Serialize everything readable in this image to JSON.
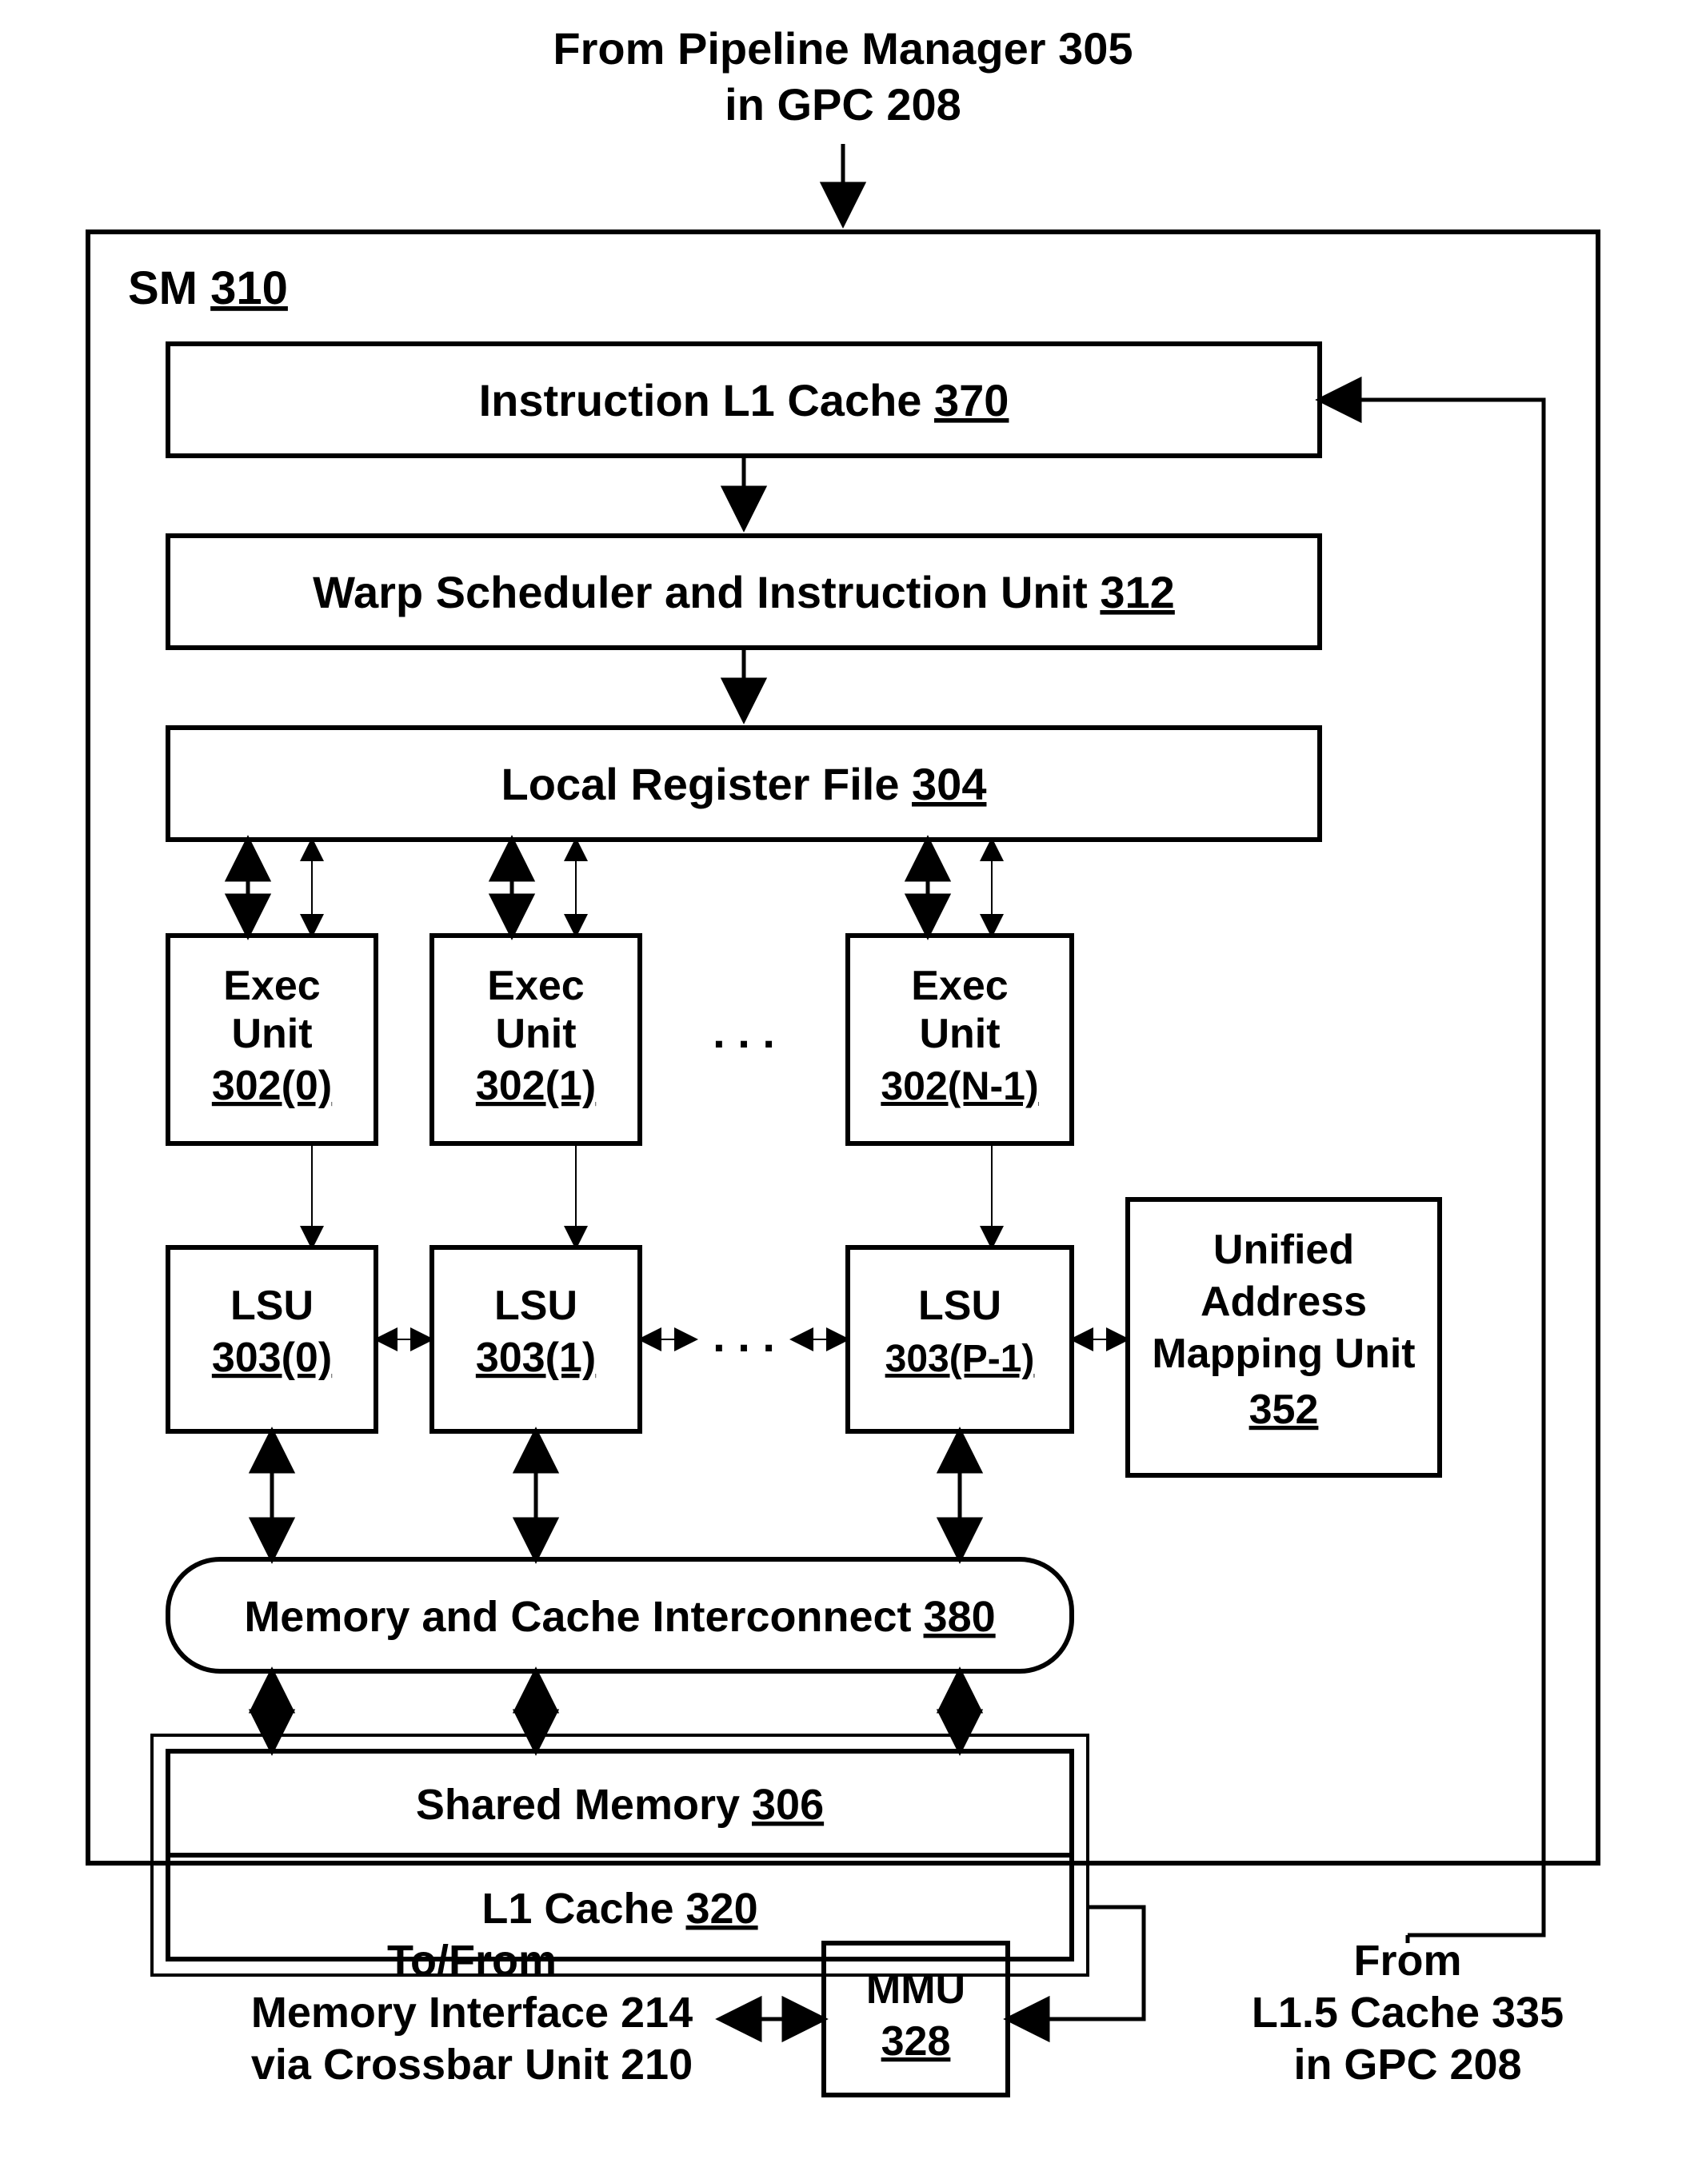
{
  "top_label_line1": "From Pipeline Manager 305",
  "top_label_line2": "in GPC 208",
  "sm_label": "SM ",
  "sm_num": "310",
  "instr_cache_label": "Instruction L1 Cache ",
  "instr_cache_num": "370",
  "warp_label": "Warp Scheduler and Instruction Unit ",
  "warp_num": "312",
  "local_reg_label": "Local Register File ",
  "local_reg_num": "304",
  "exec_label": "Exec",
  "unit_label": "Unit",
  "exec0_num": "302(0)",
  "exec1_num": "302(1)",
  "execN_num": "302(N-1)",
  "lsu_label": "LSU",
  "lsu0_num": "303(0)",
  "lsu1_num": "303(1)",
  "lsuP_num": "303(P-1)",
  "uamu_line1": "Unified",
  "uamu_line2": "Address",
  "uamu_line3": "Mapping Unit",
  "uamu_num": "352",
  "mem_interconnect_label": "Memory and Cache Interconnect ",
  "mem_interconnect_num": "380",
  "shared_mem_label": "Shared Memory ",
  "shared_mem_num": "306",
  "l1_cache_label": "L1 Cache ",
  "l1_cache_num": "320",
  "bottom_left_line1": "To/From",
  "bottom_left_line2": "Memory Interface 214",
  "bottom_left_line3": "via Crossbar Unit 210",
  "mmu_label": "MMU",
  "mmu_num": "328",
  "bottom_right_line1": "From",
  "bottom_right_line2": "L1.5 Cache 335",
  "bottom_right_line3": "in GPC 208",
  "ellipsis": ". . ."
}
